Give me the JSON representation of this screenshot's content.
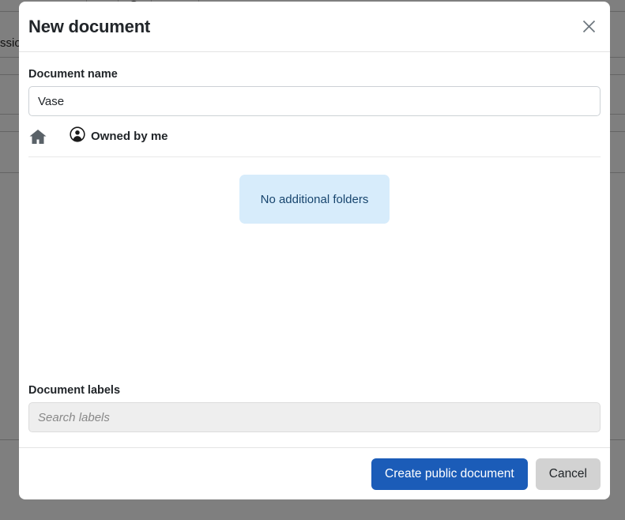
{
  "background": {
    "partial_text": "ssio",
    "toolbar_icons": [
      "chevron-down-icon",
      "search-icon"
    ]
  },
  "modal": {
    "title": "New document",
    "close_icon": "close-icon",
    "document_name": {
      "label": "Document name",
      "value": "Vase",
      "placeholder": ""
    },
    "owner": {
      "home_icon": "home-icon",
      "account_icon": "account-circle-icon",
      "text": "Owned by me"
    },
    "folders": {
      "empty_message": "No additional folders"
    },
    "labels": {
      "label": "Document labels",
      "value": "",
      "placeholder": "Search labels"
    },
    "footer": {
      "primary_label": "Create public document",
      "secondary_label": "Cancel"
    }
  },
  "colors": {
    "primary_button": "#1b5cb8",
    "secondary_button": "#d2d2d2",
    "info_box_bg": "#d7ecfb",
    "info_box_text": "#17456e",
    "overlay": "#7d7f80"
  }
}
